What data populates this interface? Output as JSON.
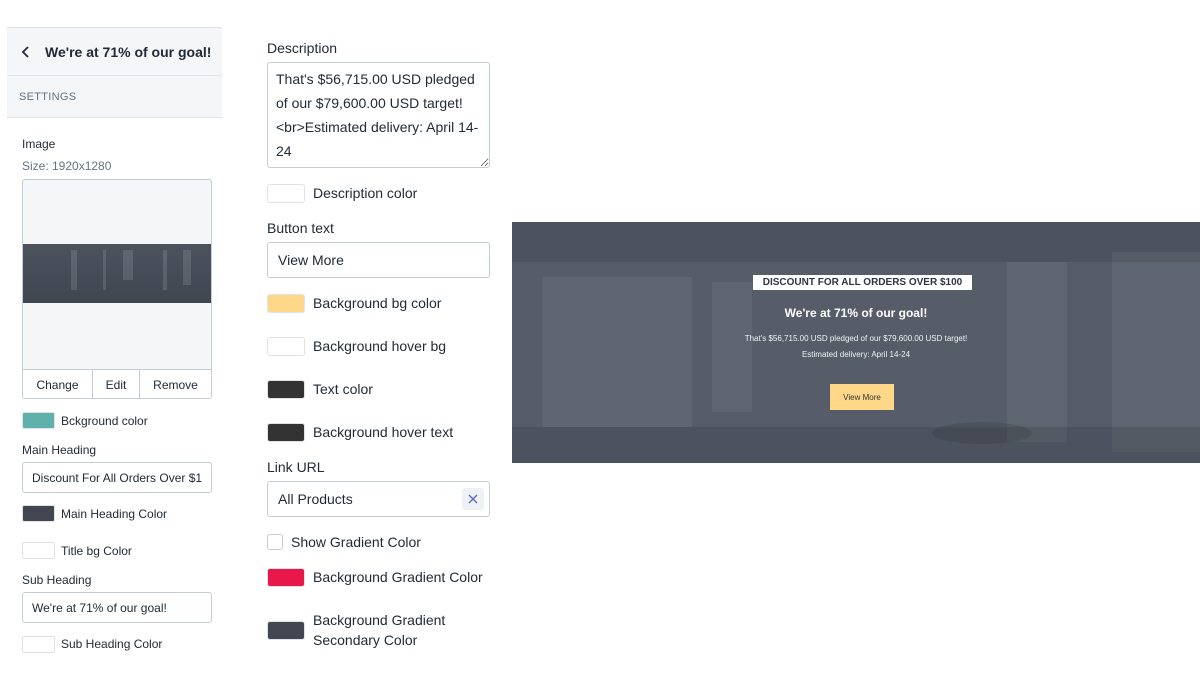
{
  "sidebar": {
    "title": "We're at 71% of our goal!",
    "section_label": "SETTINGS",
    "image": {
      "label": "Image",
      "size_hint": "Size: 1920x1280",
      "actions": [
        "Change",
        "Edit",
        "Remove"
      ]
    },
    "background_color": {
      "label": "Bckground color",
      "color": "#5fb1ab"
    },
    "main_heading": {
      "label": "Main Heading",
      "value": "Discount For All Orders Over $100"
    },
    "main_heading_color": {
      "label": "Main Heading Color",
      "color": "#414650"
    },
    "title_bg_color": {
      "label": "Title bg Color",
      "color": "#ffffff"
    },
    "sub_heading": {
      "label": "Sub Heading",
      "value": "We're at 71% of our goal!"
    },
    "sub_heading_color": {
      "label": "Sub Heading Color",
      "color": "#ffffff"
    }
  },
  "form": {
    "description": {
      "label": "Description",
      "value": "That's $56,715.00 USD pledged of our $79,600.00 USD target! <br>Estimated delivery: April 14-24"
    },
    "description_color": {
      "label": "Description color",
      "color": "#ffffff"
    },
    "button_text": {
      "label": "Button text",
      "value": "View More"
    },
    "background_bg_color": {
      "label": "Background bg color",
      "color": "#fed789"
    },
    "background_hover_bg": {
      "label": "Background hover bg",
      "color": "#ffffff"
    },
    "text_color": {
      "label": "Text color",
      "color": "#333333"
    },
    "background_hover_text": {
      "label": "Background hover text",
      "color": "#333333"
    },
    "link_url": {
      "label": "Link URL",
      "value": "All Products"
    },
    "show_gradient": {
      "label": "Show Gradient Color",
      "checked": false
    },
    "gradient_color": {
      "label": "Background Gradient Color",
      "color": "#e8184a"
    },
    "gradient_secondary": {
      "label_line1": "Background Gradient",
      "label_line2": "Secondary Color",
      "color": "#414650"
    }
  },
  "preview": {
    "badge": "DISCOUNT FOR ALL ORDERS OVER $100",
    "heading": "We're at 71% of our goal!",
    "description_line1": "That's $56,715.00 USD pledged of our $79,600.00 USD target!",
    "description_line2": "Estimated delivery: April 14-24",
    "button": "View More",
    "overlay_color": "#565d69"
  }
}
